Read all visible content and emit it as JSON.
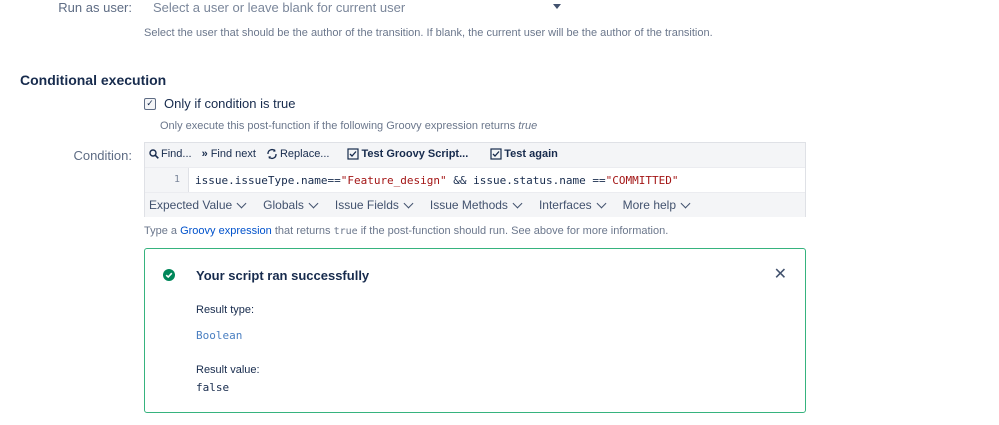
{
  "run_as": {
    "label": "Run as user:",
    "placeholder": "Select a user or leave blank for current user",
    "help": "Select the user that should be the author of the transition. If blank, the current user will be the author of the transition."
  },
  "section": {
    "title": "Conditional execution"
  },
  "condition_toggle": {
    "label": "Only if condition is true",
    "checked": true,
    "help_prefix": "Only execute this post-function if the following Groovy expression returns ",
    "help_em": "true"
  },
  "condition": {
    "label": "Condition:",
    "toolbar": {
      "find": "Find...",
      "find_next": "Find next",
      "replace": "Replace...",
      "test_script": "Test Groovy Script...",
      "test_again": "Test again"
    },
    "line_number": "1",
    "code_parts": {
      "p1": "issue.issueType.name==",
      "s1": "\"Feature_design\"",
      "p2": " && issue.status.name ==",
      "s2": "\"COMMITTED\""
    },
    "menus": [
      "Expected Value",
      "Globals",
      "Issue Fields",
      "Issue Methods",
      "Interfaces",
      "More help"
    ],
    "help": {
      "prefix": "Type a ",
      "link": "Groovy expression",
      "mid": " that returns ",
      "code": "true",
      "suffix": " if the post-function should run. See above for more information."
    }
  },
  "result": {
    "title": "Your script ran successfully",
    "type_label": "Result type:",
    "type_value": "Boolean",
    "value_label": "Result value:",
    "value": "false",
    "colors": {
      "success_border": "#36b37e",
      "success_icon": "#00875a",
      "type_value": "#4a7fc1"
    }
  }
}
